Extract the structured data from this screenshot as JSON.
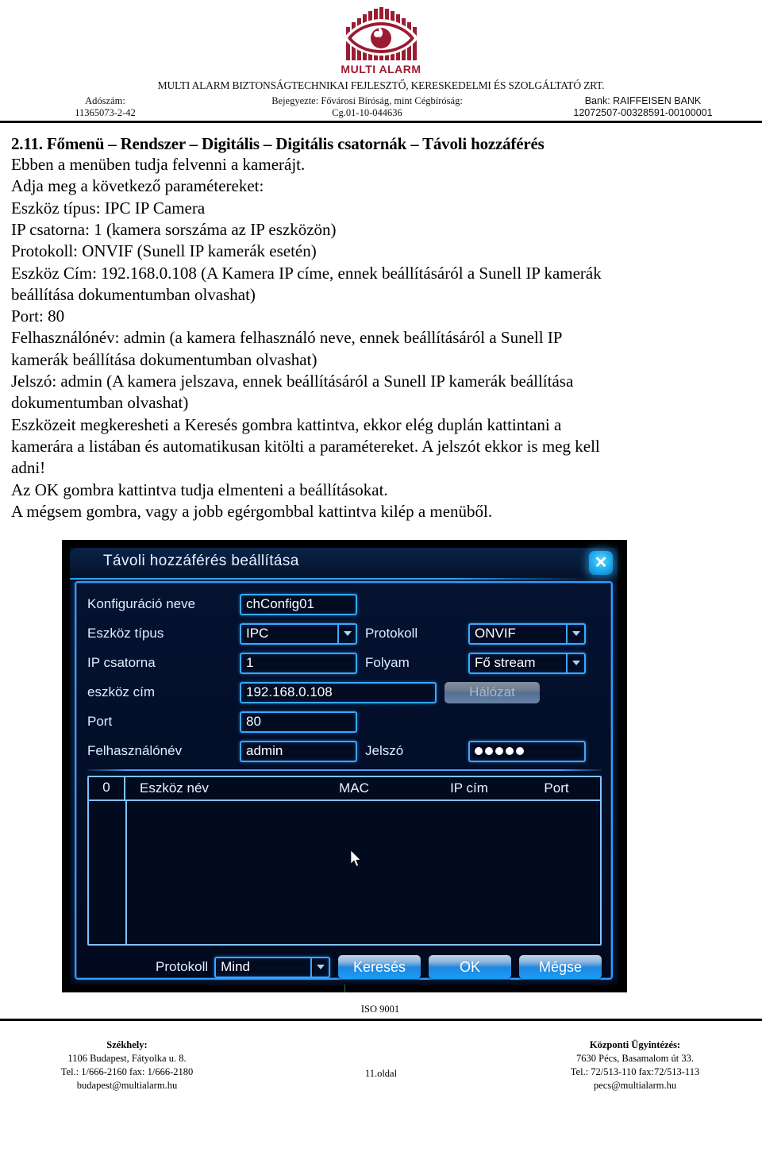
{
  "header": {
    "logo_text": "MULTI ALARM",
    "logo_color": "#9B1B30",
    "company": "MULTI ALARM  BIZTONSÁGTECHNIKAI FEJLESZTŐ, KERESKEDELMI ÉS SZOLGÁLTATÓ ZRT.",
    "tax_label": "Adószám:",
    "tax_value": "11365073-2-42",
    "reg_label": "Bejegyezte:  Fővárosi Bíróság, mint Cégbíróság:",
    "reg_value": "Cg.01-10-044636",
    "bank_label": "Bank: RAIFFEISEN BANK",
    "bank_value": "12072507-00328591-00100001"
  },
  "document": {
    "section_title": "2.11. Főmenü – Rendszer – Digitális – Digitális csatornák – Távoli hozzáférés",
    "lines": [
      "Ebben a menüben tudja felvenni a kamerájt.",
      "Adja meg a következő paramétereket:",
      "Eszköz típus: IPC IP Camera",
      "IP csatorna: 1 (kamera sorszáma az IP eszközön)",
      "Protokoll: ONVIF (Sunell IP kamerák esetén)",
      "Eszköz Cím: 192.168.0.108 (A Kamera IP címe, ennek beállításáról a Sunell IP kamerák",
      "beállítása dokumentumban olvashat)",
      "Port: 80",
      "Felhasználónév: admin (a kamera felhasználó neve,  ennek beállításáról a Sunell IP",
      "kamerák beállítása dokumentumban olvashat)",
      "Jelszó:  admin (A kamera jelszava, ennek beállításáról a Sunell IP kamerák beállítása",
      "dokumentumban olvashat)",
      "Eszközeit megkeresheti a Keresés gombra kattintva, ekkor elég duplán kattintani a",
      "kamerára a listában és automatikusan kitölti a paramétereket. A jelszót ekkor is meg kell",
      "adni!",
      "Az OK gombra kattintva tudja elmenteni a  beállításokat.",
      "A mégsem gombra, vagy a jobb egérgombbal kattintva kilép a menüből."
    ]
  },
  "dialog": {
    "title": "Távoli hozzáférés beállítása",
    "close_label": "✕",
    "fields": {
      "config_name_label": "Konfiguráció neve",
      "config_name_value": "chConfig01",
      "device_type_label": "Eszköz típus",
      "device_type_value": "IPC",
      "protocol_label": "Protokoll",
      "protocol_value": "ONVIF",
      "ip_channel_label": "IP csatorna",
      "ip_channel_value": "1",
      "stream_label": "Folyam",
      "stream_value": "Fő stream",
      "device_addr_label": "eszköz cím",
      "device_addr_value": "192.168.0.108",
      "network_button_label": "Hálózat",
      "port_label": "Port",
      "port_value": "80",
      "username_label": "Felhasználónév",
      "username_value": "admin",
      "password_label": "Jelszó",
      "password_dots": 5
    },
    "table": {
      "index_header": "0",
      "columns": [
        "Eszköz név",
        "MAC",
        "IP cím",
        "Port"
      ],
      "rows": []
    },
    "actions": {
      "protocol_label": "Protokoll",
      "protocol_value": "Mind",
      "search_label": "Keresés",
      "ok_label": "OK",
      "cancel_label": "Mégse"
    }
  },
  "footer": {
    "iso": "ISO 9001",
    "page": "11.oldal",
    "left": {
      "title": "Székhely:",
      "line1": "1106 Budapest, Fátyolka u. 8.",
      "line2": "Tel.: 1/666-2160 fax: 1/666-2180",
      "line3": "budapest@multialarm.hu"
    },
    "right": {
      "title": "Központi Ügyintézés:",
      "line1": "7630 Pécs, Basamalom út 33.",
      "line2": "Tel.: 72/513-110 fax:72/513-113",
      "line3": "pecs@multialarm.hu"
    }
  }
}
